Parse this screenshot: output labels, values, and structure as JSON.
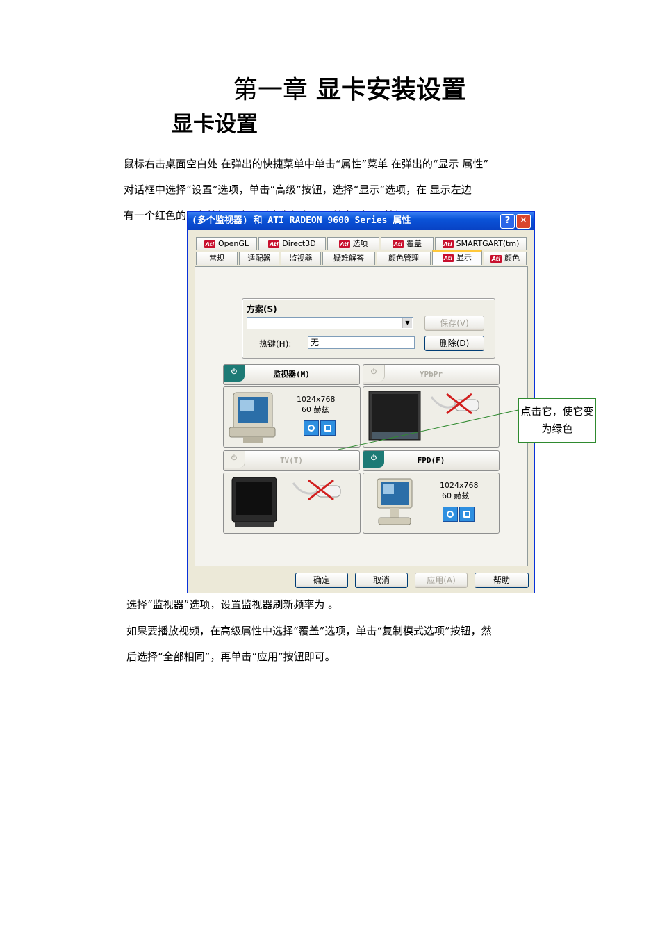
{
  "doc": {
    "chapter_title_prefix": "第一章",
    "chapter_title": "显卡安装设置",
    "section_title": "显卡设置",
    "para1_line1": "鼠标右击桌面空白处  在弹出的快捷菜单中单击“属性”菜单  在弹出的“显示  属性”",
    "para1_line2": "对话框中选择“设置”选项，单击“高级”按钮，选择“显示”选项，在        显示左边",
    "para1_line3": "有一个红色的三角按钮，点击后变为绿色，再单击“应用”按钮即可。",
    "para2": "选择“监视器”选项，设置监视器刷新频率为         。",
    "para3_line1": "如果要播放视频，在高级属性中选择“覆盖”选项，单击“复制模式选项”按钮，然",
    "para3_line2": "后选择“全部相同”，再单击“应用”按钮即可。",
    "annotation": "点击它，使它变为绿色"
  },
  "dialog": {
    "title": "(多个监视器) 和 ATI RADEON 9600 Series  属性",
    "help_glyph": "?",
    "close_glyph": "✕",
    "ati_badge": "Ati",
    "tabs_row1": [
      "OpenGL",
      "Direct3D",
      "选项",
      "覆盖",
      "SMARTGART(tm)"
    ],
    "tabs_row2": [
      "常规",
      "适配器",
      "监视器",
      "疑难解答",
      "颜色管理",
      "显示",
      "颜色"
    ],
    "active_tab": "显示",
    "scheme_label": "方案(S)",
    "scheme_value": "",
    "save_button": "保存(V)",
    "hotkey_label": "热键(H):",
    "hotkey_value": "无",
    "delete_button": "删除(D)",
    "power_glyph": "⏻",
    "devices": [
      {
        "name": "监视器(M)",
        "enabled": true,
        "resolution": "1024x768",
        "refresh": "60 赫兹"
      },
      {
        "name": "YPbPr",
        "enabled": false
      },
      {
        "name": "TV(T)",
        "enabled": false
      },
      {
        "name": "FPD(F)",
        "enabled": true,
        "resolution": "1024x768",
        "refresh": "60 赫兹"
      }
    ],
    "ok_button": "确定",
    "cancel_button": "取消",
    "apply_button": "应用(A)",
    "help_button": "帮助"
  }
}
